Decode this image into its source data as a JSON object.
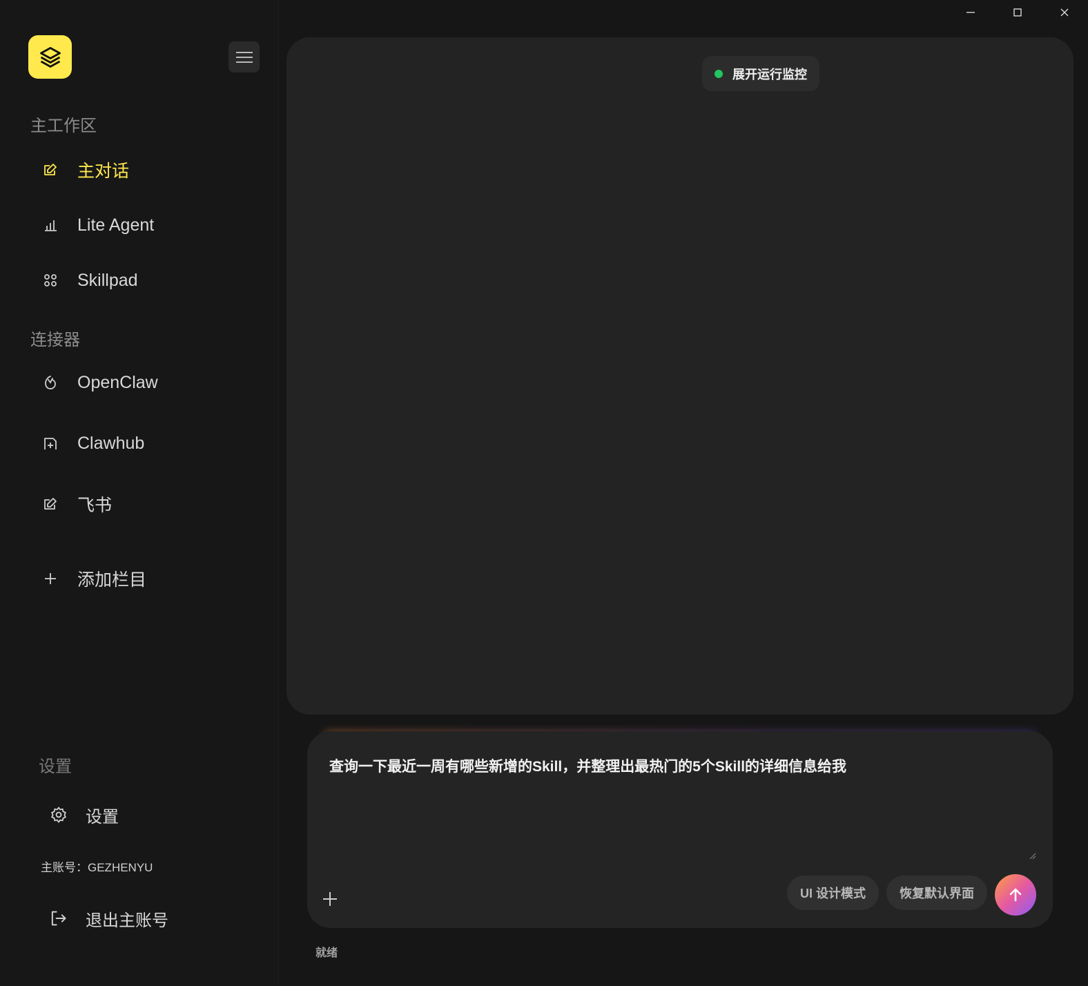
{
  "window": {
    "controls": [
      "minimize-icon",
      "maximize-icon",
      "close-icon"
    ]
  },
  "sidebar": {
    "workspace_title": "主工作区",
    "workspace_items": [
      {
        "label": "主对话",
        "icon": "edit-icon",
        "active": true
      },
      {
        "label": "Lite Agent",
        "icon": "bar-chart-icon",
        "active": false
      },
      {
        "label": "Skillpad",
        "icon": "grid-dots-icon",
        "active": false
      }
    ],
    "connector_title": "连接器",
    "connector_items": [
      {
        "label": "OpenClaw",
        "icon": "claw-icon"
      },
      {
        "label": "Clawhub",
        "icon": "hub-icon"
      },
      {
        "label": "飞书",
        "icon": "edit-icon"
      }
    ],
    "add_column_label": "添加栏目",
    "settings_title": "设置",
    "settings_label": "设置",
    "account_label": "主账号：GEZHENYU",
    "logout_label": "退出主账号"
  },
  "main": {
    "monitor_label": "展开运行监控"
  },
  "composer": {
    "value": "查询一下最近一周有哪些新增的Skill，并整理出最热门的5个Skill的详细信息给我",
    "ui_mode_label": "UI 设计模式",
    "reset_label": "恢复默认界面"
  },
  "status_text": "就绪",
  "colors": {
    "accent": "#ffe94d",
    "status_dot": "#22c55e"
  }
}
